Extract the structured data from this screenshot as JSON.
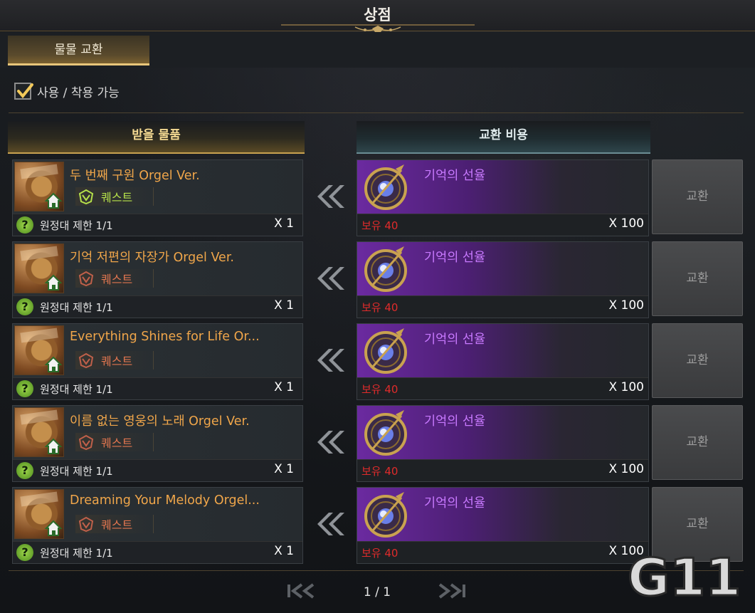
{
  "title": "상점",
  "tab": {
    "label": "물물 교환"
  },
  "filter": {
    "label": "사용 / 착용 가능",
    "checked": true
  },
  "headers": {
    "receive": "받을 물품",
    "cost": "교환 비용"
  },
  "rows": [
    {
      "name": "두 번째 구원 Orgel Ver.",
      "tag": "퀘스트",
      "tag_state": "active",
      "limit": "원정대 제한 1/1",
      "qty": "X 1",
      "cost_name": "기억의 선율",
      "owned": "보유 40",
      "cost_qty": "X 100",
      "button": "교환"
    },
    {
      "name": "기억 저편의 자장가 Orgel Ver.",
      "tag": "퀘스트",
      "tag_state": "inactive",
      "limit": "원정대 제한 1/1",
      "qty": "X 1",
      "cost_name": "기억의 선율",
      "owned": "보유 40",
      "cost_qty": "X 100",
      "button": "교환"
    },
    {
      "name": "Everything Shines for Life Or...",
      "tag": "퀘스트",
      "tag_state": "inactive",
      "limit": "원정대 제한 1/1",
      "qty": "X 1",
      "cost_name": "기억의 선율",
      "owned": "보유 40",
      "cost_qty": "X 100",
      "button": "교환"
    },
    {
      "name": "이름 없는 영웅의 노래 Orgel Ver.",
      "tag": "퀘스트",
      "tag_state": "inactive",
      "limit": "원정대 제한 1/1",
      "qty": "X 1",
      "cost_name": "기억의 선율",
      "owned": "보유 40",
      "cost_qty": "X 100",
      "button": "교환"
    },
    {
      "name": "Dreaming Your Melody Orgel...",
      "tag": "퀘스트",
      "tag_state": "inactive",
      "limit": "원정대 제한 1/1",
      "qty": "X 1",
      "cost_name": "기억의 선율",
      "owned": "보유 40",
      "cost_qty": "X 100",
      "button": "교환"
    }
  ],
  "pagination": {
    "label": "1 / 1"
  },
  "watermark": {
    "text": "G11"
  },
  "colors": {
    "item_name": "#f0a64a",
    "cost_name": "#c879ff",
    "owned_insufficient": "#e02b2b",
    "quest_active": "#b5e04a",
    "quest_inactive": "#e0754f",
    "gold_accent": "#c9a250"
  },
  "icons": {
    "back_arrow": "double-chevron-left-icon",
    "help": "question-mark-icon",
    "home_badge": "home-icon",
    "quest": "quest-emblem-icon",
    "first_page": "first-page-icon",
    "prev_page": "prev-page-icon",
    "next_page": "next-page-icon",
    "last_page": "last-page-icon"
  }
}
